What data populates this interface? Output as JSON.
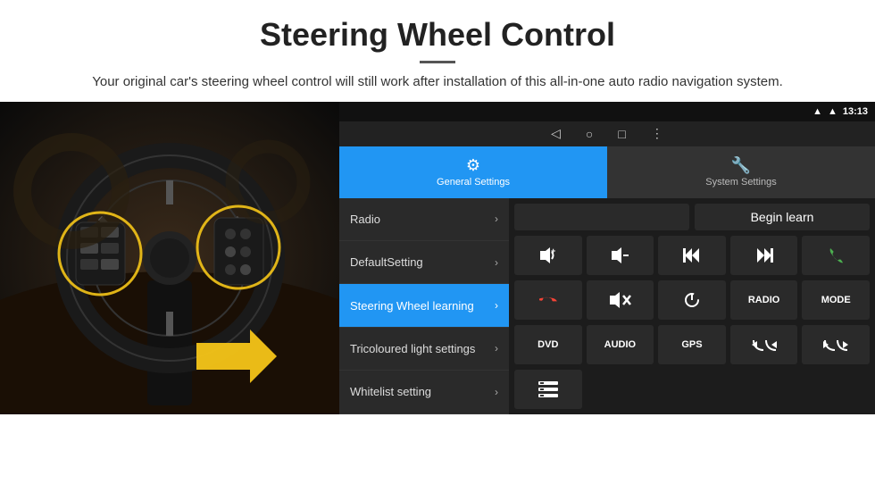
{
  "header": {
    "title": "Steering Wheel Control",
    "divider": "",
    "subtitle": "Your original car's steering wheel control will still work after installation of this all-in-one auto radio navigation system."
  },
  "statusBar": {
    "signal": "▾",
    "wifi": "▾",
    "time": "13:13"
  },
  "navBar": {
    "back": "◁",
    "home": "○",
    "square": "□",
    "dots": "⋮"
  },
  "tabs": [
    {
      "id": "general",
      "icon": "⚙",
      "label": "General Settings",
      "active": true
    },
    {
      "id": "system",
      "icon": "🔧",
      "label": "System Settings",
      "active": false
    }
  ],
  "menuItems": [
    {
      "id": "radio",
      "label": "Radio",
      "active": false
    },
    {
      "id": "default",
      "label": "DefaultSetting",
      "active": false
    },
    {
      "id": "steering",
      "label": "Steering Wheel learning",
      "active": true
    },
    {
      "id": "tricoloured",
      "label": "Tricoloured light settings",
      "active": false
    },
    {
      "id": "whitelist",
      "label": "Whitelist setting",
      "active": false
    }
  ],
  "buttons": {
    "beginLearn": "Begin learn",
    "row1": [
      {
        "id": "vol-up",
        "icon": "🔊+",
        "label": "vol-up"
      },
      {
        "id": "vol-down",
        "icon": "🔉−",
        "label": "vol-down"
      },
      {
        "id": "prev-track",
        "icon": "⏮",
        "label": "prev-track"
      },
      {
        "id": "next-track",
        "icon": "⏭",
        "label": "next-track"
      },
      {
        "id": "phone",
        "icon": "📞",
        "label": "phone"
      }
    ],
    "row2": [
      {
        "id": "hang-up",
        "icon": "☎",
        "label": "hang-up"
      },
      {
        "id": "mute",
        "icon": "🔇×",
        "label": "mute"
      },
      {
        "id": "power",
        "icon": "⏻",
        "label": "power"
      },
      {
        "id": "radio-btn",
        "text": "RADIO",
        "label": "radio-button"
      },
      {
        "id": "mode-btn",
        "text": "MODE",
        "label": "mode-button"
      }
    ],
    "row3": [
      {
        "id": "dvd-btn",
        "text": "DVD",
        "label": "dvd-button"
      },
      {
        "id": "audio-btn",
        "text": "AUDIO",
        "label": "audio-button"
      },
      {
        "id": "gps-btn",
        "text": "GPS",
        "label": "gps-button"
      },
      {
        "id": "tel-prev",
        "icon": "📞⏮",
        "label": "tel-prev"
      },
      {
        "id": "tel-next",
        "icon": "📞⏭",
        "label": "tel-next"
      }
    ],
    "row4": [
      {
        "id": "list-btn",
        "icon": "≡",
        "label": "list-button"
      }
    ]
  }
}
